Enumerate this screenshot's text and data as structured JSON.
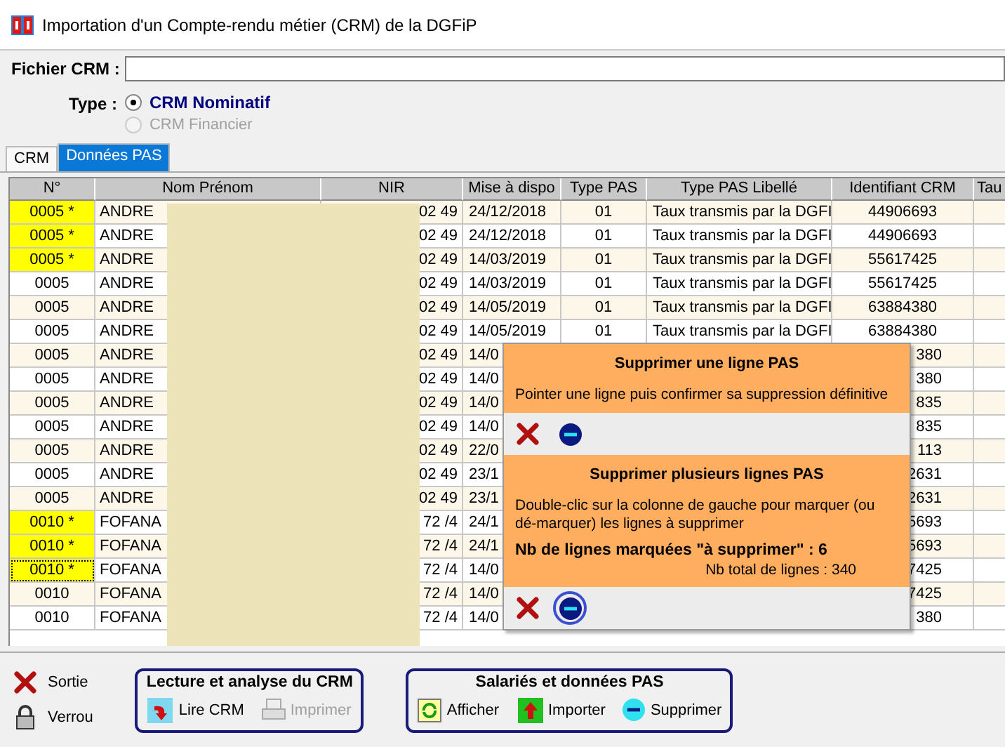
{
  "window": {
    "title": "Importation d'un Compte-rendu métier (CRM) de la DGFiP"
  },
  "file_field": {
    "label": "Fichier CRM :"
  },
  "type": {
    "label": "Type :",
    "options": [
      {
        "label": "CRM Nominatif",
        "selected": true,
        "disabled": false
      },
      {
        "label": "CRM Financier",
        "selected": false,
        "disabled": true
      }
    ]
  },
  "tabs": [
    {
      "label": "CRM",
      "selected": false
    },
    {
      "label": "Données PAS",
      "selected": true
    }
  ],
  "table": {
    "columns": [
      "N°",
      "Nom Prénom",
      "NIR",
      "Mise à dispo",
      "Type PAS",
      "Type PAS Libellé",
      "Identifiant CRM",
      "Tau"
    ],
    "rows": [
      {
        "n": "0005 *",
        "marked": true,
        "focused": false,
        "name": "ANDRE",
        "nir": "02 49",
        "date": "24/12/2018",
        "type": "01",
        "label": "Taux transmis par la DGFI",
        "id": "44906693"
      },
      {
        "n": "0005 *",
        "marked": true,
        "focused": false,
        "name": "ANDRE",
        "nir": "02 49",
        "date": "24/12/2018",
        "type": "01",
        "label": "Taux transmis par la DGFI",
        "id": "44906693"
      },
      {
        "n": "0005 *",
        "marked": true,
        "focused": false,
        "name": "ANDRE",
        "nir": "02 49",
        "date": "14/03/2019",
        "type": "01",
        "label": "Taux transmis par la DGFI",
        "id": "55617425"
      },
      {
        "n": "0005",
        "marked": false,
        "focused": false,
        "name": "ANDRE",
        "nir": "02 49",
        "date": "14/03/2019",
        "type": "01",
        "label": "Taux transmis par la DGFI",
        "id": "55617425"
      },
      {
        "n": "0005",
        "marked": false,
        "focused": false,
        "name": "ANDRE",
        "nir": "02 49",
        "date": "14/05/2019",
        "type": "01",
        "label": "Taux transmis par la DGFI",
        "id": "63884380"
      },
      {
        "n": "0005",
        "marked": false,
        "focused": false,
        "name": "ANDRE",
        "nir": "02 49",
        "date": "14/05/2019",
        "type": "01",
        "label": "Taux transmis par la DGFI",
        "id": "63884380"
      },
      {
        "n": "0005",
        "marked": false,
        "focused": false,
        "name": "ANDRE",
        "nir": "02 49",
        "date": "14/0",
        "id": "380"
      },
      {
        "n": "0005",
        "marked": false,
        "focused": false,
        "name": "ANDRE",
        "nir": "02 49",
        "date": "14/0",
        "id": "380"
      },
      {
        "n": "0005",
        "marked": false,
        "focused": false,
        "name": "ANDRE",
        "nir": "02 49",
        "date": "14/0",
        "id": "835"
      },
      {
        "n": "0005",
        "marked": false,
        "focused": false,
        "name": "ANDRE",
        "nir": "02 49",
        "date": "14/0",
        "id": "835"
      },
      {
        "n": "0005",
        "marked": false,
        "focused": false,
        "name": "ANDRE",
        "nir": "02 49",
        "date": "22/0",
        "id": "113"
      },
      {
        "n": "0005",
        "marked": false,
        "focused": false,
        "name": "ANDRE",
        "nir": "02 49",
        "date": "23/1",
        "id": "2631"
      },
      {
        "n": "0005",
        "marked": false,
        "focused": false,
        "name": "ANDRE",
        "nir": "02 49",
        "date": "23/1",
        "id": "2631"
      },
      {
        "n": "0010 *",
        "marked": true,
        "focused": false,
        "name": "FOFANA",
        "nir": "72 /4",
        "date": "24/1",
        "id": "5693"
      },
      {
        "n": "0010 *",
        "marked": true,
        "focused": false,
        "name": "FOFANA",
        "nir": "72 /4",
        "date": "24/1",
        "id": "5693"
      },
      {
        "n": "0010 *",
        "marked": true,
        "focused": true,
        "name": "FOFANA",
        "nir": "72 /4",
        "date": "14/0",
        "id": "7425"
      },
      {
        "n": "0010",
        "marked": false,
        "focused": false,
        "name": "FOFANA",
        "nir": "72 /4",
        "date": "14/0",
        "id": "7425"
      },
      {
        "n": "0010",
        "marked": false,
        "focused": false,
        "name": "FOFANA",
        "nir": "72 /4",
        "date": "14/0",
        "id": "380"
      }
    ]
  },
  "popup": {
    "sections": [
      {
        "title": "Supprimer une ligne PAS",
        "text": "Pointer une ligne puis confirmer sa suppression définitive",
        "highlighted": false
      },
      {
        "title": "Supprimer plusieurs lignes PAS",
        "text": "Double-clic sur la colonne de gauche pour marquer (ou dé-marquer) les lignes à supprimer",
        "count": "Nb de lignes marquées \"à supprimer\" : 6",
        "total": "Nb total de lignes : 340",
        "highlighted": true
      }
    ]
  },
  "bottom": {
    "exits": [
      {
        "kind": "exit",
        "label": "Sortie"
      },
      {
        "kind": "lock",
        "label": "Verrou"
      }
    ],
    "groups": [
      {
        "title": "Lecture et analyse du CRM",
        "buttons": [
          {
            "kind": "xml",
            "label": "Lire CRM",
            "disabled": false
          },
          {
            "kind": "print",
            "label": "Imprimer",
            "disabled": true
          }
        ]
      },
      {
        "title": "Salariés et données PAS",
        "buttons": [
          {
            "kind": "show",
            "label": "Afficher",
            "disabled": false
          },
          {
            "kind": "import",
            "label": "Importer",
            "disabled": false
          },
          {
            "kind": "delete",
            "label": "Supprimer",
            "disabled": false
          }
        ]
      }
    ]
  }
}
